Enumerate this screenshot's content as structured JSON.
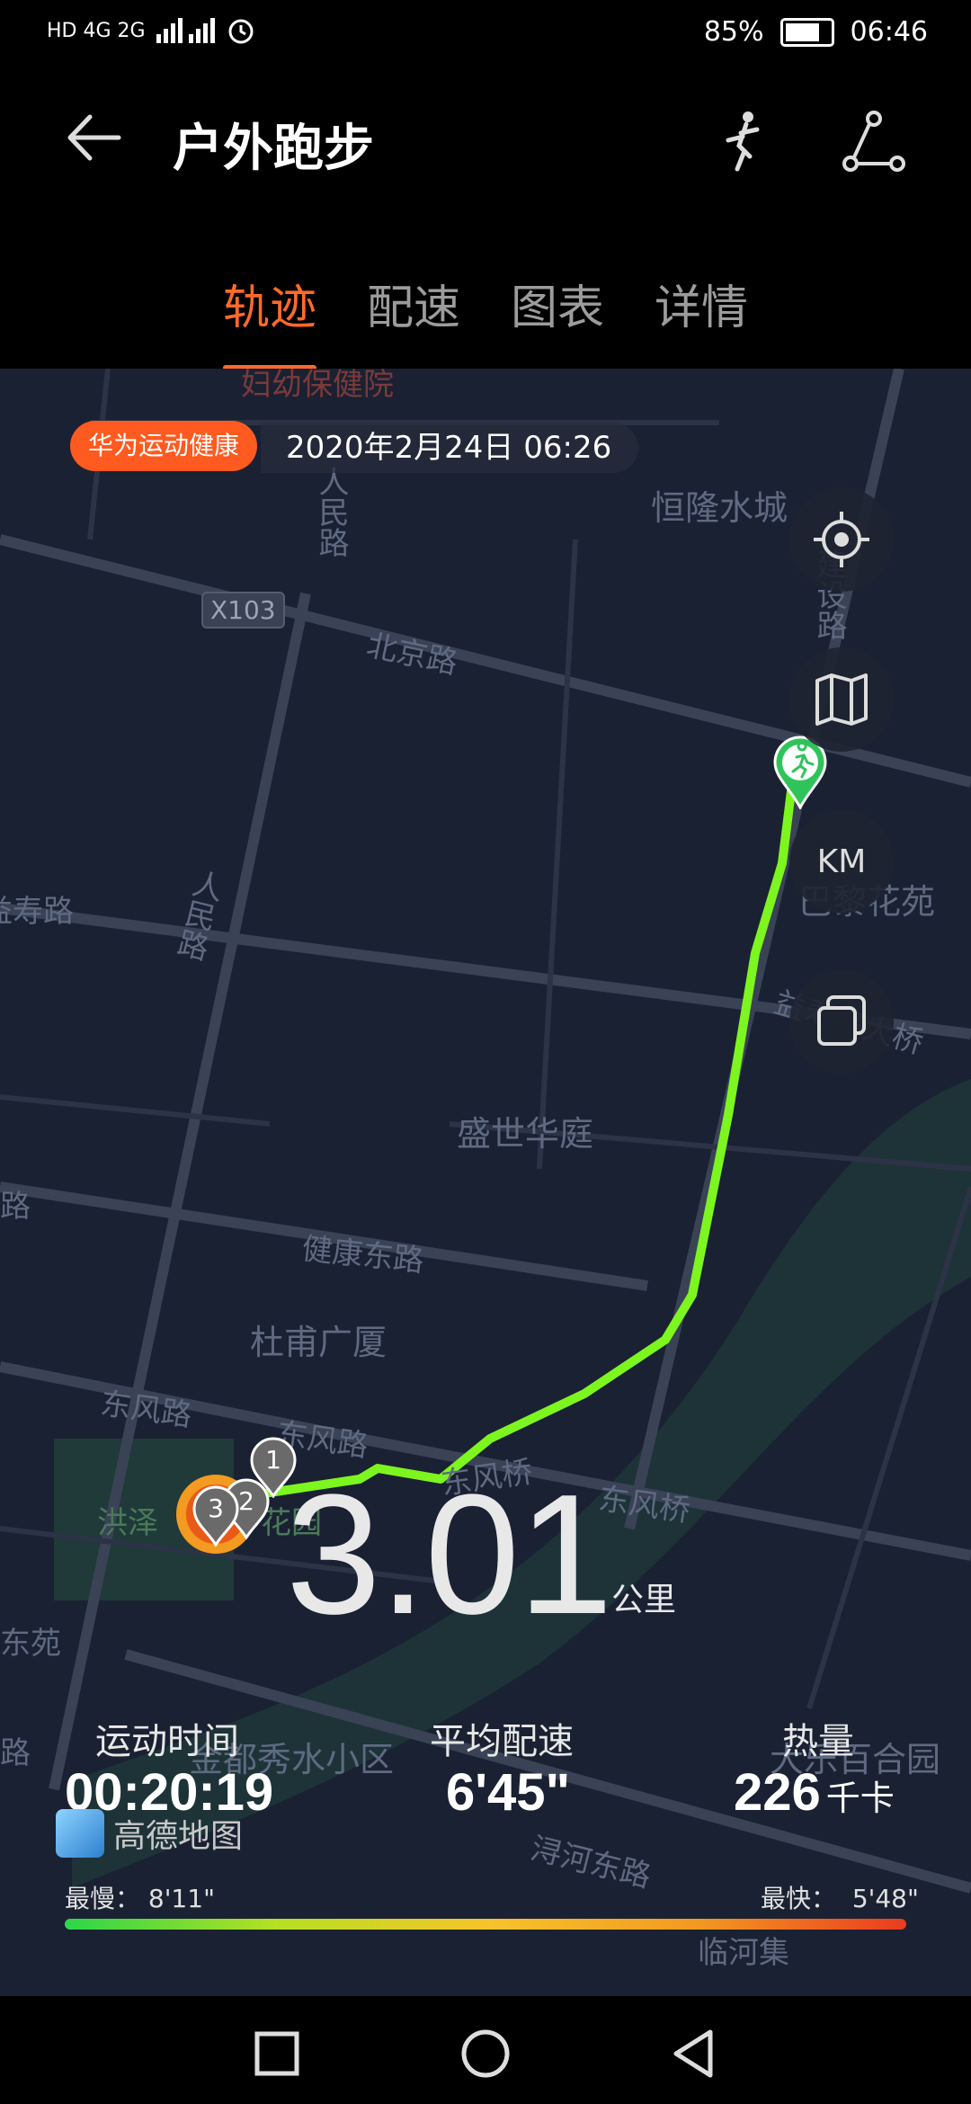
{
  "status_bar": {
    "network_left": "HD 4G 2G",
    "battery": "85%",
    "battery_level": 0.85,
    "time": "06:46"
  },
  "header": {
    "title": "户外跑步",
    "back_icon": "back-arrow-icon",
    "run_icon": "runner-icon",
    "route_icon": "route-share-icon"
  },
  "tabs": [
    {
      "label": "轨迹",
      "active": true
    },
    {
      "label": "配速",
      "active": false
    },
    {
      "label": "图表",
      "active": false
    },
    {
      "label": "详情",
      "active": false
    }
  ],
  "map": {
    "badge": "华为运动健康",
    "date": "2020年2月24日 06:26",
    "km_button": "KM",
    "road_label": "X103",
    "labels": [
      "妇幼保健院",
      "恒隆水城",
      "北京路",
      "人民路",
      "建设路",
      "巴黎花苑",
      "益寿路",
      "益寿路大桥",
      "盛世华庭",
      "健康东路",
      "杜甫广厦",
      "东风路",
      "东风路",
      "东风桥",
      "东风桥",
      "洪泽",
      "花园",
      "人民路",
      "路",
      "东苑",
      "路",
      "金都秀水小区",
      "大乐百合园",
      "浔河东路",
      "临河集"
    ],
    "markers": [
      "1",
      "2",
      "3"
    ],
    "provider": "高德地图"
  },
  "summary": {
    "distance": "3.01",
    "distance_unit": "公里",
    "duration_label": "运动时间",
    "duration_value": "00:20:19",
    "pace_label": "平均配速",
    "pace_value": "6'45\"",
    "calories_label": "热量",
    "calories_value": "226",
    "calories_unit": "千卡"
  },
  "pace_legend": {
    "slowest_label": "最慢：",
    "slowest_value": "8'11\"",
    "fastest_label": "最快：",
    "fastest_value": "5'48\""
  },
  "colors": {
    "accent": "#ff6a2a",
    "track": "#7df51f",
    "map_bg": "#1a2132"
  }
}
